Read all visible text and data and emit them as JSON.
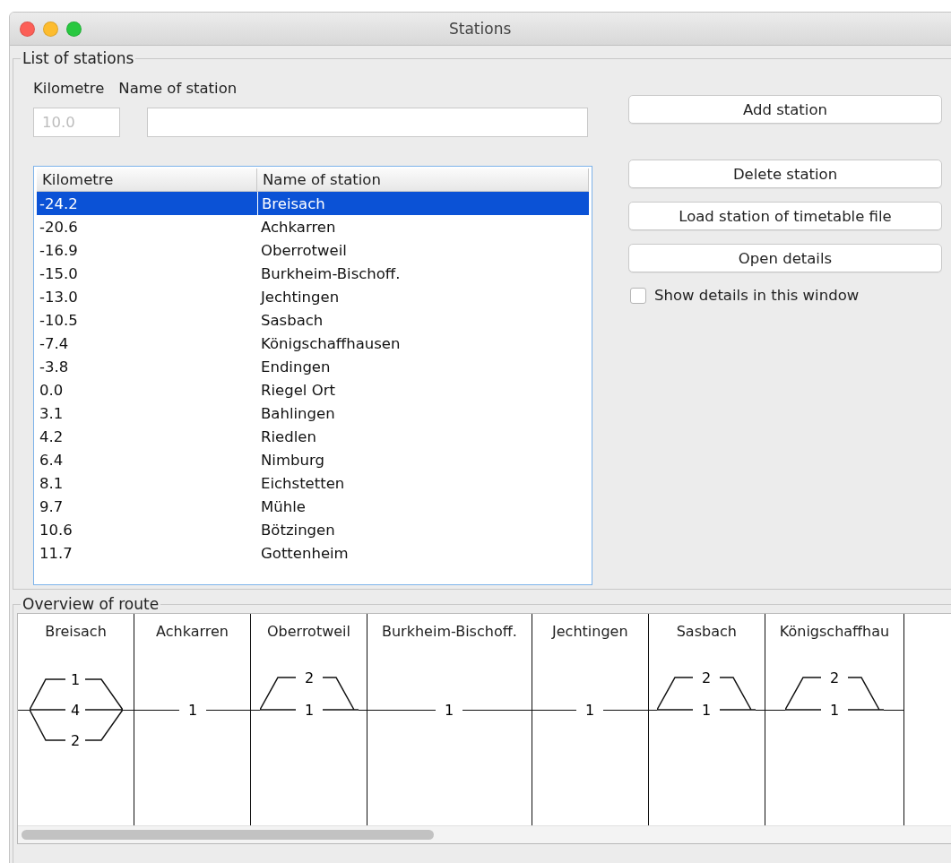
{
  "window": {
    "title": "Stations"
  },
  "list_of_stations": {
    "legend": "List of stations",
    "kilometre_label": "Kilometre",
    "name_label": "Name of station",
    "kilometre_field": {
      "placeholder": "10.0"
    },
    "table": {
      "columns": [
        "Kilometre",
        "Name of station"
      ],
      "rows": [
        {
          "kilometre": "-24.2",
          "name": "Breisach",
          "selected": true
        },
        {
          "kilometre": "-20.6",
          "name": "Achkarren",
          "selected": false
        },
        {
          "kilometre": "-16.9",
          "name": "Oberrotweil",
          "selected": false
        },
        {
          "kilometre": "-15.0",
          "name": "Burkheim-Bischoff.",
          "selected": false
        },
        {
          "kilometre": "-13.0",
          "name": "Jechtingen",
          "selected": false
        },
        {
          "kilometre": "-10.5",
          "name": "Sasbach",
          "selected": false
        },
        {
          "kilometre": "-7.4",
          "name": "Königschaffhausen",
          "selected": false
        },
        {
          "kilometre": "-3.8",
          "name": "Endingen",
          "selected": false
        },
        {
          "kilometre": "0.0",
          "name": "Riegel Ort",
          "selected": false
        },
        {
          "kilometre": "3.1",
          "name": "Bahlingen",
          "selected": false
        },
        {
          "kilometre": "4.2",
          "name": "Riedlen",
          "selected": false
        },
        {
          "kilometre": "6.4",
          "name": "Nimburg",
          "selected": false
        },
        {
          "kilometre": "8.1",
          "name": "Eichstetten",
          "selected": false
        },
        {
          "kilometre": "9.7",
          "name": "Mühle",
          "selected": false
        },
        {
          "kilometre": "10.6",
          "name": "Bötzingen",
          "selected": false
        },
        {
          "kilometre": "11.7",
          "name": "Gottenheim",
          "selected": false
        }
      ]
    },
    "buttons": {
      "add": "Add station",
      "others": [
        "Delete station",
        "Load station of timetable file",
        "Open details"
      ]
    },
    "checkbox": {
      "label": "Show details in this window",
      "checked": false
    }
  },
  "overview_of_route": {
    "legend": "Overview of route",
    "stations": [
      {
        "name": "Breisach",
        "kind": "three-track",
        "tracks": [
          "1",
          "4",
          "2"
        ]
      },
      {
        "name": "Achkarren",
        "kind": "single",
        "tracks": [
          "1"
        ]
      },
      {
        "name": "Oberrotweil",
        "kind": "passing-above",
        "tracks": [
          "2",
          "1"
        ]
      },
      {
        "name": "Burkheim-Bischoff.",
        "kind": "single",
        "tracks": [
          "1"
        ]
      },
      {
        "name": "Jechtingen",
        "kind": "single",
        "tracks": [
          "1"
        ]
      },
      {
        "name": "Sasbach",
        "kind": "passing-above",
        "tracks": [
          "2",
          "1"
        ]
      },
      {
        "name": "Königschaffhau",
        "kind": "passing-above",
        "tracks": [
          "2",
          "1"
        ]
      }
    ]
  }
}
